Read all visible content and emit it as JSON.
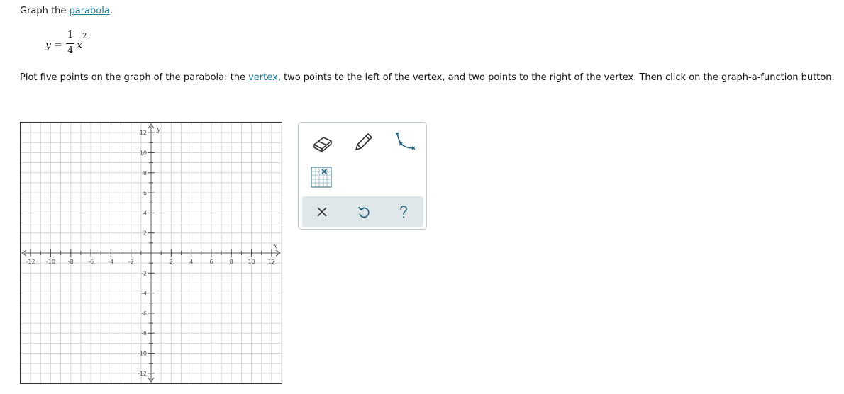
{
  "question": {
    "title_prefix": "Graph the ",
    "title_link": "parabola",
    "title_suffix": ".",
    "equation": {
      "lhs": "y",
      "equals": "=",
      "numerator": "1",
      "denominator": "4",
      "variable": "x",
      "exponent": "2"
    },
    "instructions": {
      "part1": "Plot five points on the graph of the parabola: the ",
      "vertex_link": "vertex",
      "part2": ", two points to the left of the vertex, and two points to the right of the vertex. Then click on the graph-a-function button."
    }
  },
  "graph": {
    "x_label": "x",
    "y_label": "y",
    "x_range": [
      -13,
      13
    ],
    "y_range": [
      -13,
      13
    ],
    "grid_step": 1,
    "label_step": 2,
    "x_tick_labels": [
      "-12",
      "-10",
      "-8",
      "-6",
      "-4",
      "-2",
      "2",
      "4",
      "6",
      "8",
      "10",
      "12"
    ],
    "y_tick_labels": [
      "12",
      "10",
      "8",
      "6",
      "4",
      "2",
      "-2",
      "-4",
      "-6",
      "-8",
      "-10",
      "-12"
    ],
    "colors": {
      "grid": "#d4d4d4",
      "axis": "#555555",
      "label": "#555555"
    }
  },
  "tools": {
    "items": [
      {
        "name": "eraser-tool",
        "icon": "eraser-icon"
      },
      {
        "name": "pencil-tool",
        "icon": "pencil-icon"
      },
      {
        "name": "graph-function-tool",
        "icon": "curve-icon"
      },
      {
        "name": "point-grid-tool",
        "icon": "grid-point-icon"
      }
    ],
    "actions": [
      {
        "name": "clear-button",
        "icon": "close-icon"
      },
      {
        "name": "undo-button",
        "icon": "undo-icon"
      },
      {
        "name": "help-button",
        "icon": "help-icon"
      }
    ],
    "accent": "#1f5f7a"
  }
}
